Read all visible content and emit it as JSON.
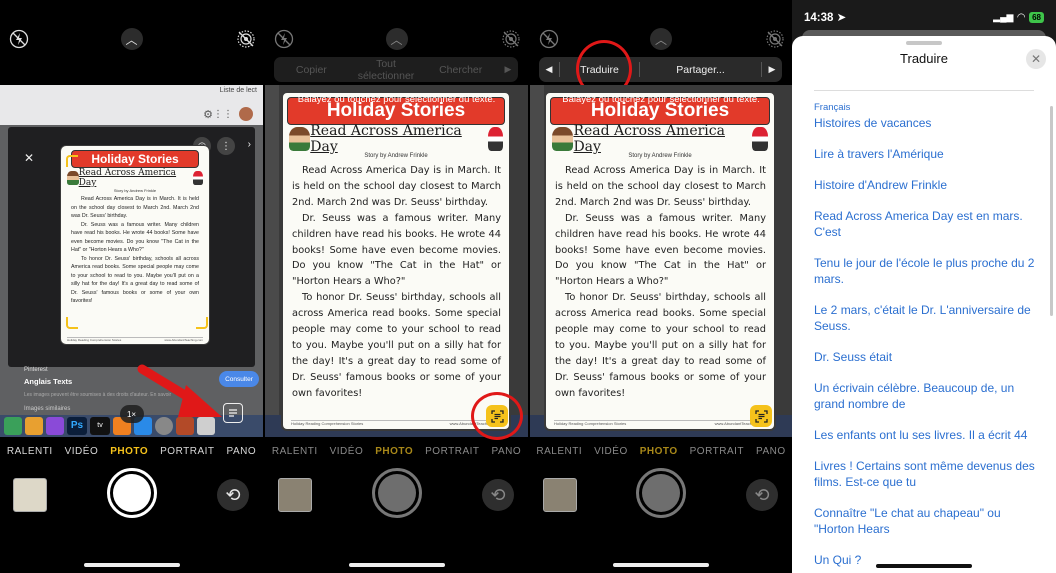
{
  "camera": {
    "modes": [
      "RALENTI",
      "VIDÉO",
      "PHOTO",
      "PORTRAIT",
      "PANO"
    ],
    "active_mode": "PHOTO",
    "zoom": "1×"
  },
  "doc": {
    "banner": "Holiday Stories",
    "title": "Read Across America Day",
    "byline": "Story by Andrew Frinkle",
    "paragraphs": [
      "Read Across America Day is in March. It is held on the school day closest to March 2nd. March 2nd was Dr. Seuss' birthday.",
      "Dr. Seuss was a famous writer. Many children have read his books. He wrote 44 books! Some have even become movies. Do you know \"The Cat in the Hat\" or \"Horton Hears a Who?\"",
      "To honor Dr. Seuss' birthday, schools all across America read books. Some special people may come to your school to read to you. Maybe you'll put on a silly hat for the day! It's a great day to read some of Dr. Seuss' famous books or some of your own favorites!"
    ],
    "footer_left": "Holiday Reading Comprehension Stories",
    "footer_right": "www.AbundantTeaching.com"
  },
  "panel1": {
    "browser_reading_list": "Liste de lect",
    "pinterest_label": "Pinterest",
    "pinterest_title": "Anglais Texts",
    "copyright_note": "Les images peuvent être soumises à des droits d'auteur. En savoir",
    "similar_images": "Images similaires",
    "consult_button": "Consulter",
    "dock_ps": "Ps",
    "dock_tv": "tv"
  },
  "panel2": {
    "instruction": "Balayez ou touchez pour sélectionner du texte.",
    "menu": [
      "Copier",
      "Tout sélectionner",
      "Chercher"
    ]
  },
  "panel3": {
    "instruction": "Balayez ou touchez pour sélectionner du texte.",
    "menu": [
      "Traduire",
      "Partager..."
    ]
  },
  "phone": {
    "time": "14:38",
    "battery": "68"
  },
  "translate": {
    "title": "Traduire",
    "language": "Français",
    "lines": [
      "Histoires de vacances",
      "Lire à travers l'Amérique",
      "Histoire d'Andrew Frinkle",
      "Read Across America Day est en mars. C'est",
      "Tenu le jour de l'école le plus proche du 2 mars.",
      "Le 2 mars, c'était le Dr. L'anniversaire de Seuss.",
      "Dr. Seuss était",
      "Un écrivain célèbre. Beaucoup de, un grand nombre de",
      "Les enfants ont lu ses livres. Il a écrit 44",
      "Livres ! Certains sont même devenus des films. Est-ce que tu",
      "Connaître \"Le chat au chapeau\" ou \"Horton Hears",
      "Un Qui ?"
    ]
  },
  "colors": {
    "camera_accent": "#f5c21b",
    "highlight_ring": "#e01818",
    "link_blue": "#2b6fd0",
    "banner_red": "#e23a2a"
  }
}
